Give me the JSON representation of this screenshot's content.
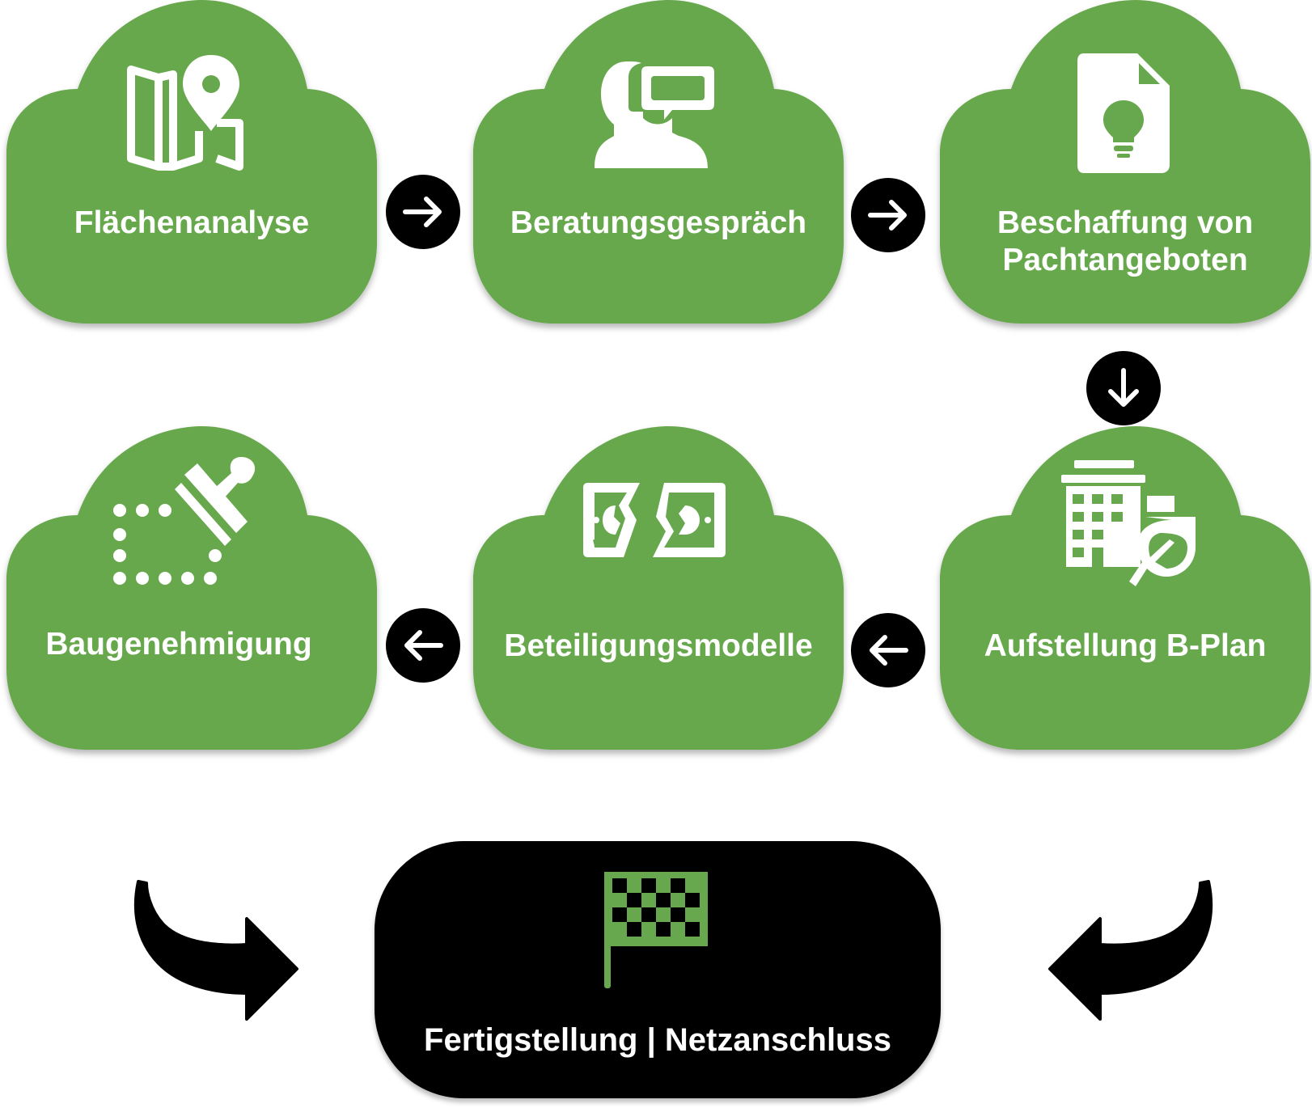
{
  "steps": [
    {
      "id": "flaechenanalyse",
      "label": "Flächenanalyse",
      "icon": "map-pin-icon"
    },
    {
      "id": "beratungsgespraech",
      "label": "Beratungsgespräch",
      "icon": "consultation-icon"
    },
    {
      "id": "beschaffung",
      "label_line1": "Beschaffung von",
      "label_line2": "Pachtangeboten",
      "icon": "document-lightbulb-icon"
    },
    {
      "id": "aufstellung",
      "label": "Aufstellung B-Plan",
      "icon": "building-leaf-icon"
    },
    {
      "id": "beteiligung",
      "label": "Beteiligungsmodelle",
      "icon": "money-exchange-icon"
    },
    {
      "id": "baugenehmigung",
      "label": "Baugenehmigung",
      "icon": "stamp-approval-icon"
    }
  ],
  "final": {
    "label": "Fertigstellung | Netzanschluss",
    "icon": "checkered-flag-icon"
  },
  "colors": {
    "step_fill": "#67a84e",
    "arrow_fill": "#000000",
    "final_fill": "#000000",
    "text": "#ffffff"
  }
}
